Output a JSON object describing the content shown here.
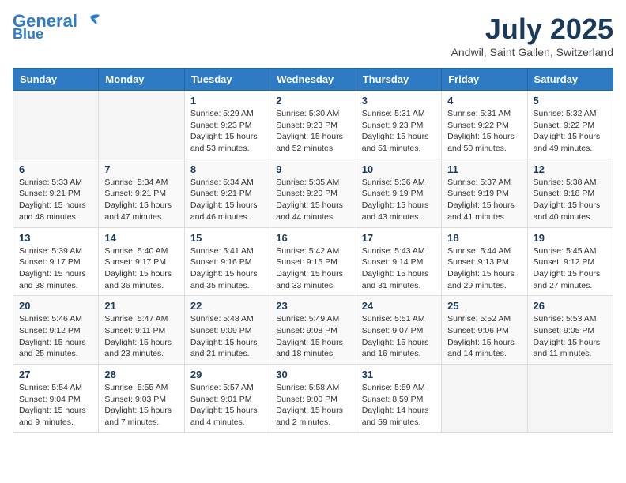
{
  "header": {
    "logo_line1": "General",
    "logo_line2": "Blue",
    "month_title": "July 2025",
    "location": "Andwil, Saint Gallen, Switzerland"
  },
  "weekdays": [
    "Sunday",
    "Monday",
    "Tuesday",
    "Wednesday",
    "Thursday",
    "Friday",
    "Saturday"
  ],
  "weeks": [
    [
      {
        "day": "",
        "info": ""
      },
      {
        "day": "",
        "info": ""
      },
      {
        "day": "1",
        "info": "Sunrise: 5:29 AM\nSunset: 9:23 PM\nDaylight: 15 hours\nand 53 minutes."
      },
      {
        "day": "2",
        "info": "Sunrise: 5:30 AM\nSunset: 9:23 PM\nDaylight: 15 hours\nand 52 minutes."
      },
      {
        "day": "3",
        "info": "Sunrise: 5:31 AM\nSunset: 9:23 PM\nDaylight: 15 hours\nand 51 minutes."
      },
      {
        "day": "4",
        "info": "Sunrise: 5:31 AM\nSunset: 9:22 PM\nDaylight: 15 hours\nand 50 minutes."
      },
      {
        "day": "5",
        "info": "Sunrise: 5:32 AM\nSunset: 9:22 PM\nDaylight: 15 hours\nand 49 minutes."
      }
    ],
    [
      {
        "day": "6",
        "info": "Sunrise: 5:33 AM\nSunset: 9:21 PM\nDaylight: 15 hours\nand 48 minutes."
      },
      {
        "day": "7",
        "info": "Sunrise: 5:34 AM\nSunset: 9:21 PM\nDaylight: 15 hours\nand 47 minutes."
      },
      {
        "day": "8",
        "info": "Sunrise: 5:34 AM\nSunset: 9:21 PM\nDaylight: 15 hours\nand 46 minutes."
      },
      {
        "day": "9",
        "info": "Sunrise: 5:35 AM\nSunset: 9:20 PM\nDaylight: 15 hours\nand 44 minutes."
      },
      {
        "day": "10",
        "info": "Sunrise: 5:36 AM\nSunset: 9:19 PM\nDaylight: 15 hours\nand 43 minutes."
      },
      {
        "day": "11",
        "info": "Sunrise: 5:37 AM\nSunset: 9:19 PM\nDaylight: 15 hours\nand 41 minutes."
      },
      {
        "day": "12",
        "info": "Sunrise: 5:38 AM\nSunset: 9:18 PM\nDaylight: 15 hours\nand 40 minutes."
      }
    ],
    [
      {
        "day": "13",
        "info": "Sunrise: 5:39 AM\nSunset: 9:17 PM\nDaylight: 15 hours\nand 38 minutes."
      },
      {
        "day": "14",
        "info": "Sunrise: 5:40 AM\nSunset: 9:17 PM\nDaylight: 15 hours\nand 36 minutes."
      },
      {
        "day": "15",
        "info": "Sunrise: 5:41 AM\nSunset: 9:16 PM\nDaylight: 15 hours\nand 35 minutes."
      },
      {
        "day": "16",
        "info": "Sunrise: 5:42 AM\nSunset: 9:15 PM\nDaylight: 15 hours\nand 33 minutes."
      },
      {
        "day": "17",
        "info": "Sunrise: 5:43 AM\nSunset: 9:14 PM\nDaylight: 15 hours\nand 31 minutes."
      },
      {
        "day": "18",
        "info": "Sunrise: 5:44 AM\nSunset: 9:13 PM\nDaylight: 15 hours\nand 29 minutes."
      },
      {
        "day": "19",
        "info": "Sunrise: 5:45 AM\nSunset: 9:12 PM\nDaylight: 15 hours\nand 27 minutes."
      }
    ],
    [
      {
        "day": "20",
        "info": "Sunrise: 5:46 AM\nSunset: 9:12 PM\nDaylight: 15 hours\nand 25 minutes."
      },
      {
        "day": "21",
        "info": "Sunrise: 5:47 AM\nSunset: 9:11 PM\nDaylight: 15 hours\nand 23 minutes."
      },
      {
        "day": "22",
        "info": "Sunrise: 5:48 AM\nSunset: 9:09 PM\nDaylight: 15 hours\nand 21 minutes."
      },
      {
        "day": "23",
        "info": "Sunrise: 5:49 AM\nSunset: 9:08 PM\nDaylight: 15 hours\nand 18 minutes."
      },
      {
        "day": "24",
        "info": "Sunrise: 5:51 AM\nSunset: 9:07 PM\nDaylight: 15 hours\nand 16 minutes."
      },
      {
        "day": "25",
        "info": "Sunrise: 5:52 AM\nSunset: 9:06 PM\nDaylight: 15 hours\nand 14 minutes."
      },
      {
        "day": "26",
        "info": "Sunrise: 5:53 AM\nSunset: 9:05 PM\nDaylight: 15 hours\nand 11 minutes."
      }
    ],
    [
      {
        "day": "27",
        "info": "Sunrise: 5:54 AM\nSunset: 9:04 PM\nDaylight: 15 hours\nand 9 minutes."
      },
      {
        "day": "28",
        "info": "Sunrise: 5:55 AM\nSunset: 9:03 PM\nDaylight: 15 hours\nand 7 minutes."
      },
      {
        "day": "29",
        "info": "Sunrise: 5:57 AM\nSunset: 9:01 PM\nDaylight: 15 hours\nand 4 minutes."
      },
      {
        "day": "30",
        "info": "Sunrise: 5:58 AM\nSunset: 9:00 PM\nDaylight: 15 hours\nand 2 minutes."
      },
      {
        "day": "31",
        "info": "Sunrise: 5:59 AM\nSunset: 8:59 PM\nDaylight: 14 hours\nand 59 minutes."
      },
      {
        "day": "",
        "info": ""
      },
      {
        "day": "",
        "info": ""
      }
    ]
  ]
}
